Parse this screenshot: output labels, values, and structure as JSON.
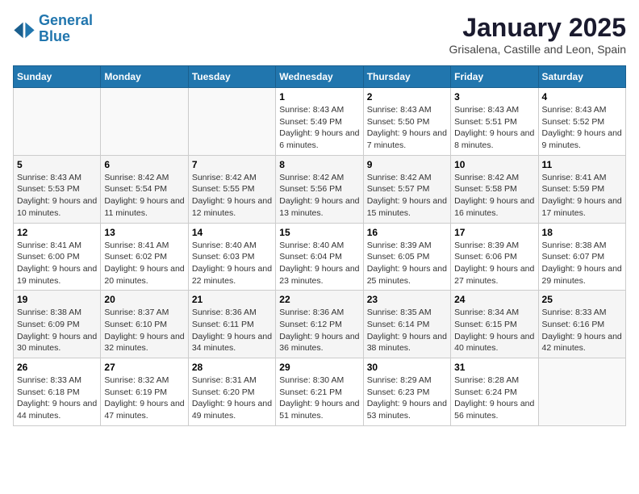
{
  "logo": {
    "line1": "General",
    "line2": "Blue"
  },
  "title": "January 2025",
  "subtitle": "Grisalena, Castille and Leon, Spain",
  "weekdays": [
    "Sunday",
    "Monday",
    "Tuesday",
    "Wednesday",
    "Thursday",
    "Friday",
    "Saturday"
  ],
  "weeks": [
    [
      {
        "day": "",
        "info": ""
      },
      {
        "day": "",
        "info": ""
      },
      {
        "day": "",
        "info": ""
      },
      {
        "day": "1",
        "info": "Sunrise: 8:43 AM\nSunset: 5:49 PM\nDaylight: 9 hours and 6 minutes."
      },
      {
        "day": "2",
        "info": "Sunrise: 8:43 AM\nSunset: 5:50 PM\nDaylight: 9 hours and 7 minutes."
      },
      {
        "day": "3",
        "info": "Sunrise: 8:43 AM\nSunset: 5:51 PM\nDaylight: 9 hours and 8 minutes."
      },
      {
        "day": "4",
        "info": "Sunrise: 8:43 AM\nSunset: 5:52 PM\nDaylight: 9 hours and 9 minutes."
      }
    ],
    [
      {
        "day": "5",
        "info": "Sunrise: 8:43 AM\nSunset: 5:53 PM\nDaylight: 9 hours and 10 minutes."
      },
      {
        "day": "6",
        "info": "Sunrise: 8:42 AM\nSunset: 5:54 PM\nDaylight: 9 hours and 11 minutes."
      },
      {
        "day": "7",
        "info": "Sunrise: 8:42 AM\nSunset: 5:55 PM\nDaylight: 9 hours and 12 minutes."
      },
      {
        "day": "8",
        "info": "Sunrise: 8:42 AM\nSunset: 5:56 PM\nDaylight: 9 hours and 13 minutes."
      },
      {
        "day": "9",
        "info": "Sunrise: 8:42 AM\nSunset: 5:57 PM\nDaylight: 9 hours and 15 minutes."
      },
      {
        "day": "10",
        "info": "Sunrise: 8:42 AM\nSunset: 5:58 PM\nDaylight: 9 hours and 16 minutes."
      },
      {
        "day": "11",
        "info": "Sunrise: 8:41 AM\nSunset: 5:59 PM\nDaylight: 9 hours and 17 minutes."
      }
    ],
    [
      {
        "day": "12",
        "info": "Sunrise: 8:41 AM\nSunset: 6:00 PM\nDaylight: 9 hours and 19 minutes."
      },
      {
        "day": "13",
        "info": "Sunrise: 8:41 AM\nSunset: 6:02 PM\nDaylight: 9 hours and 20 minutes."
      },
      {
        "day": "14",
        "info": "Sunrise: 8:40 AM\nSunset: 6:03 PM\nDaylight: 9 hours and 22 minutes."
      },
      {
        "day": "15",
        "info": "Sunrise: 8:40 AM\nSunset: 6:04 PM\nDaylight: 9 hours and 23 minutes."
      },
      {
        "day": "16",
        "info": "Sunrise: 8:39 AM\nSunset: 6:05 PM\nDaylight: 9 hours and 25 minutes."
      },
      {
        "day": "17",
        "info": "Sunrise: 8:39 AM\nSunset: 6:06 PM\nDaylight: 9 hours and 27 minutes."
      },
      {
        "day": "18",
        "info": "Sunrise: 8:38 AM\nSunset: 6:07 PM\nDaylight: 9 hours and 29 minutes."
      }
    ],
    [
      {
        "day": "19",
        "info": "Sunrise: 8:38 AM\nSunset: 6:09 PM\nDaylight: 9 hours and 30 minutes."
      },
      {
        "day": "20",
        "info": "Sunrise: 8:37 AM\nSunset: 6:10 PM\nDaylight: 9 hours and 32 minutes."
      },
      {
        "day": "21",
        "info": "Sunrise: 8:36 AM\nSunset: 6:11 PM\nDaylight: 9 hours and 34 minutes."
      },
      {
        "day": "22",
        "info": "Sunrise: 8:36 AM\nSunset: 6:12 PM\nDaylight: 9 hours and 36 minutes."
      },
      {
        "day": "23",
        "info": "Sunrise: 8:35 AM\nSunset: 6:14 PM\nDaylight: 9 hours and 38 minutes."
      },
      {
        "day": "24",
        "info": "Sunrise: 8:34 AM\nSunset: 6:15 PM\nDaylight: 9 hours and 40 minutes."
      },
      {
        "day": "25",
        "info": "Sunrise: 8:33 AM\nSunset: 6:16 PM\nDaylight: 9 hours and 42 minutes."
      }
    ],
    [
      {
        "day": "26",
        "info": "Sunrise: 8:33 AM\nSunset: 6:18 PM\nDaylight: 9 hours and 44 minutes."
      },
      {
        "day": "27",
        "info": "Sunrise: 8:32 AM\nSunset: 6:19 PM\nDaylight: 9 hours and 47 minutes."
      },
      {
        "day": "28",
        "info": "Sunrise: 8:31 AM\nSunset: 6:20 PM\nDaylight: 9 hours and 49 minutes."
      },
      {
        "day": "29",
        "info": "Sunrise: 8:30 AM\nSunset: 6:21 PM\nDaylight: 9 hours and 51 minutes."
      },
      {
        "day": "30",
        "info": "Sunrise: 8:29 AM\nSunset: 6:23 PM\nDaylight: 9 hours and 53 minutes."
      },
      {
        "day": "31",
        "info": "Sunrise: 8:28 AM\nSunset: 6:24 PM\nDaylight: 9 hours and 56 minutes."
      },
      {
        "day": "",
        "info": ""
      }
    ]
  ]
}
